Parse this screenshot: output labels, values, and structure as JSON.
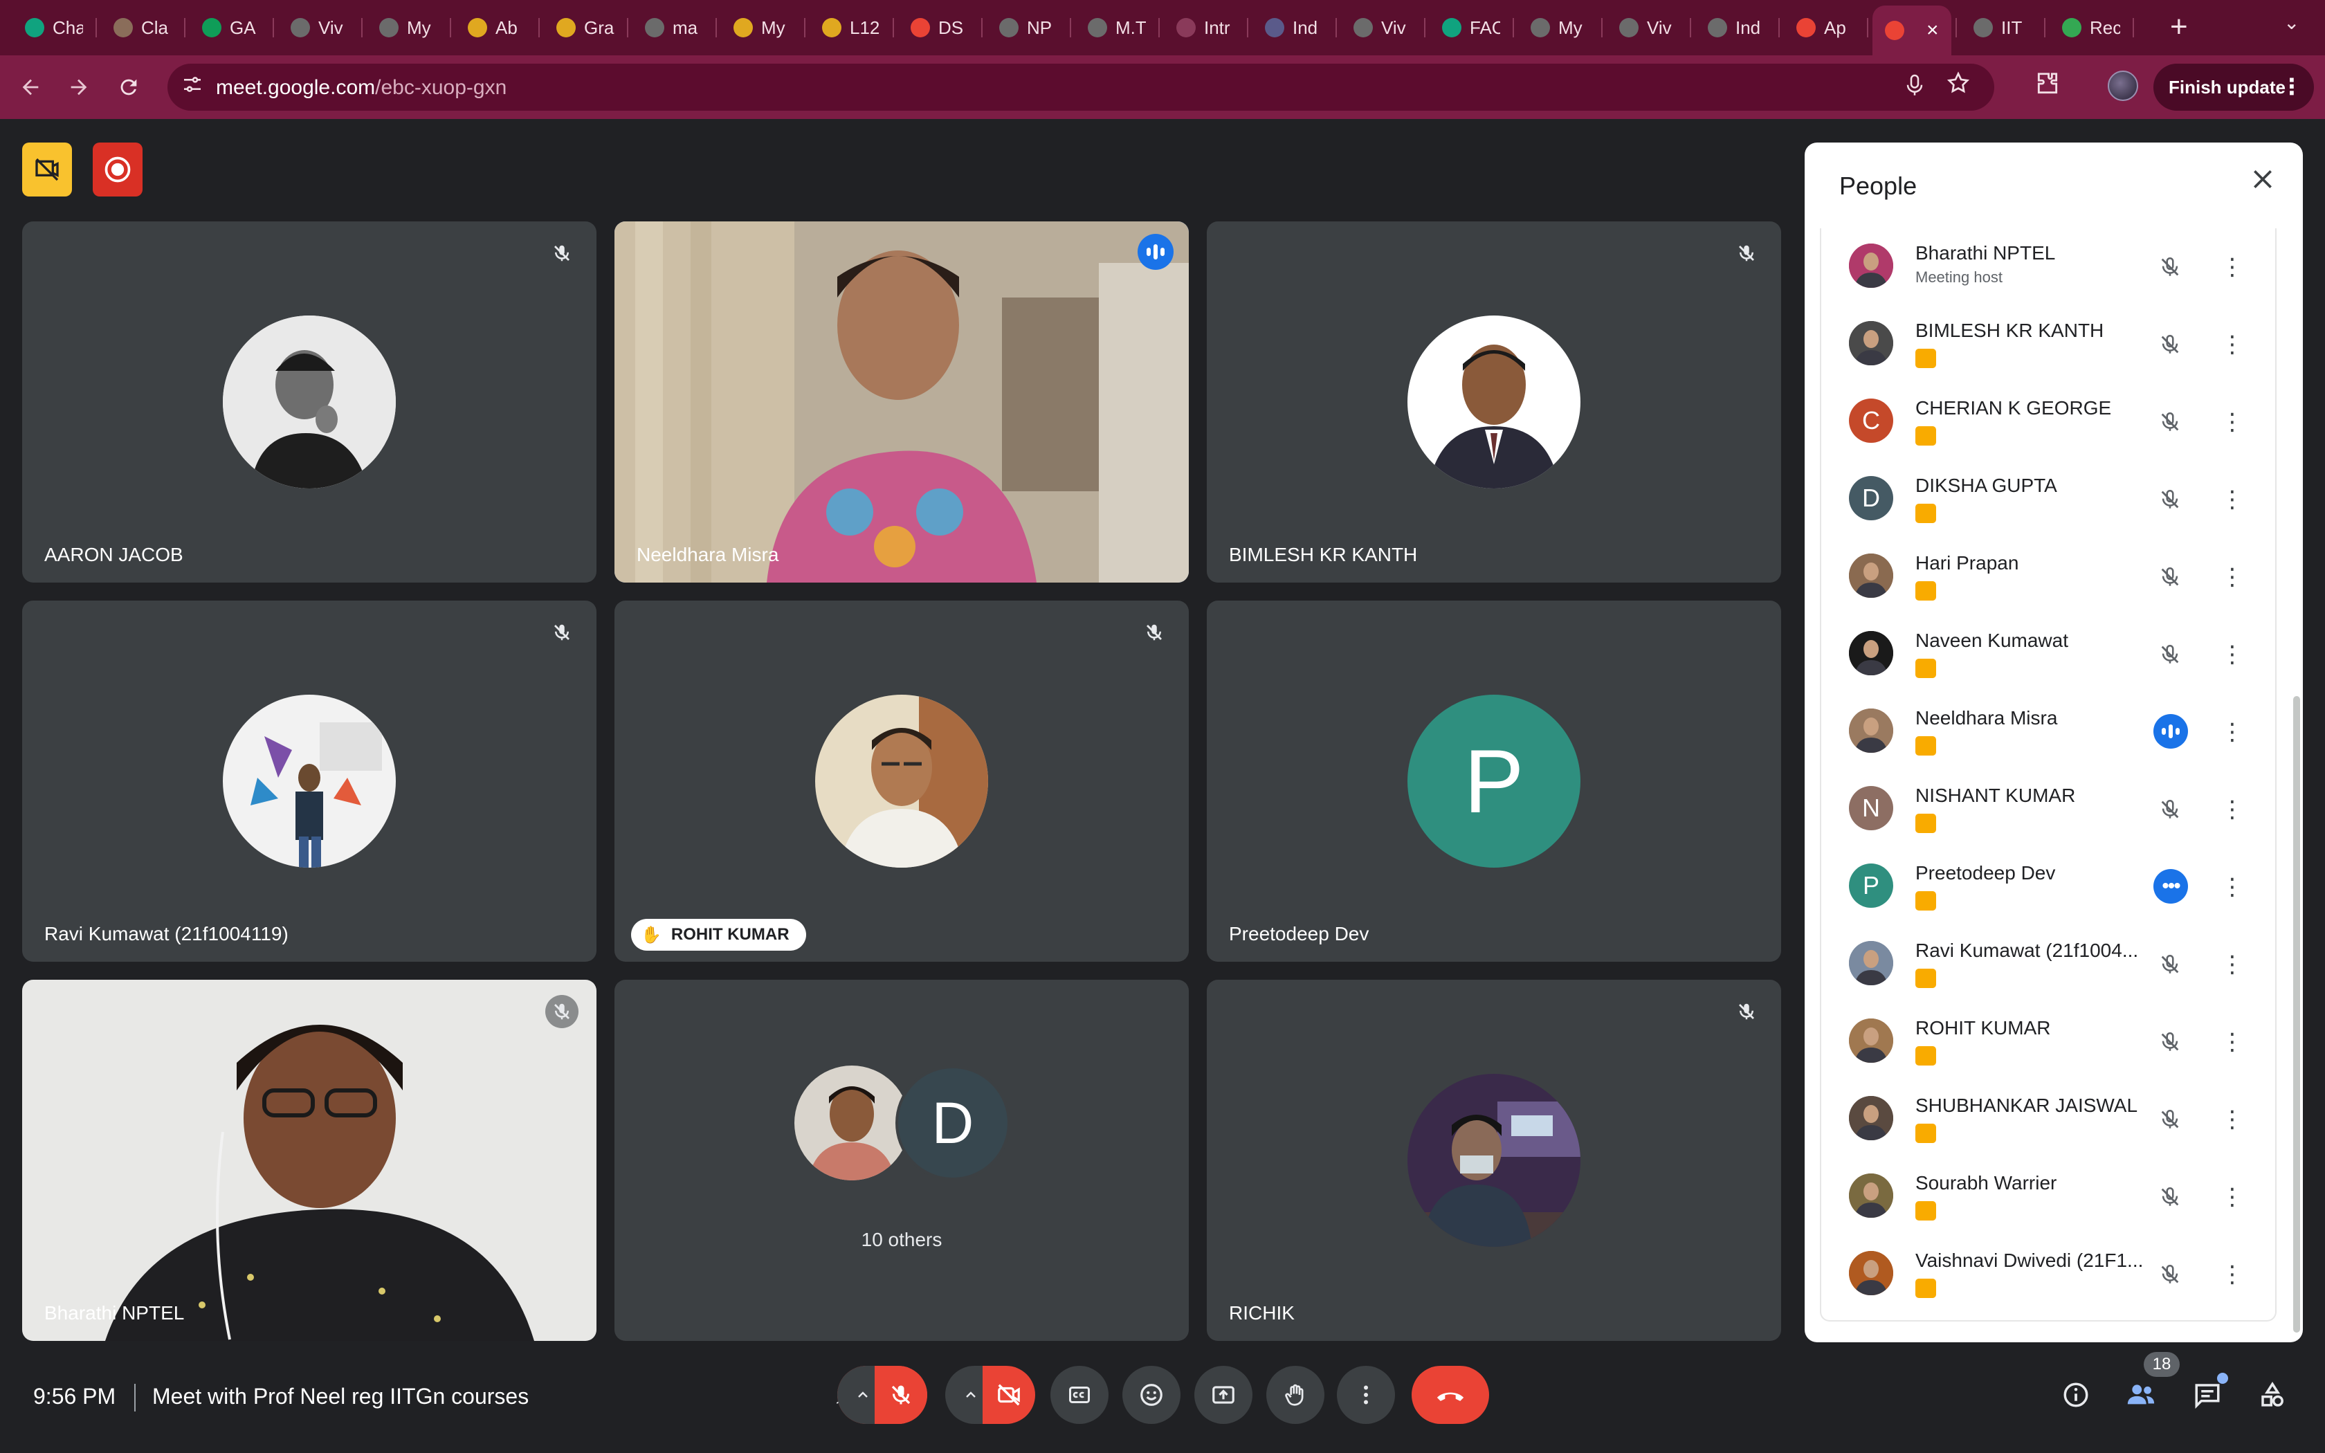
{
  "browser": {
    "tabs": [
      {
        "label": "Cha",
        "icon": "chatgpt-icon",
        "color": "#10a37f"
      },
      {
        "label": "Cla",
        "icon": "generic-app-icon",
        "color": "#8a6d5a"
      },
      {
        "label": "GA",
        "icon": "google-sheets-icon",
        "color": "#0f9d58"
      },
      {
        "label": "Viv",
        "icon": "globe-icon",
        "color": "#6b6b6b"
      },
      {
        "label": "My",
        "icon": "generic-app-icon",
        "color": "#6b6b6b"
      },
      {
        "label": "Ab",
        "icon": "smiley-icon",
        "color": "#e0a820"
      },
      {
        "label": "Gra",
        "icon": "smiley-icon",
        "color": "#e0a820"
      },
      {
        "label": "ma",
        "icon": "globe-icon",
        "color": "#6b6b6b"
      },
      {
        "label": "My",
        "icon": "smiley-icon",
        "color": "#e0a820"
      },
      {
        "label": "L12",
        "icon": "smiley-icon",
        "color": "#e0a820"
      },
      {
        "label": "DS",
        "icon": "gmail-icon",
        "color": "#ea4335"
      },
      {
        "label": "NP",
        "icon": "generic-app-icon",
        "color": "#6b6b6b"
      },
      {
        "label": "M.T",
        "icon": "generic-app-icon",
        "color": "#6b6b6b"
      },
      {
        "label": "Intr",
        "icon": "generic-app-icon",
        "color": "#8a3a5a"
      },
      {
        "label": "Ind",
        "icon": "generic-app-icon",
        "color": "#5a5a8a"
      },
      {
        "label": "Viv",
        "icon": "globe-icon",
        "color": "#6b6b6b"
      },
      {
        "label": "FAC",
        "icon": "chatgpt-icon",
        "color": "#10a37f"
      },
      {
        "label": "My",
        "icon": "generic-app-icon",
        "color": "#6b6b6b"
      },
      {
        "label": "Viv",
        "icon": "globe-icon",
        "color": "#6b6b6b"
      },
      {
        "label": "Ind",
        "icon": "generic-app-icon",
        "color": "#6b6b6b"
      },
      {
        "label": "Ap",
        "icon": "gmail-icon",
        "color": "#ea4335"
      },
      {
        "label": "",
        "icon": "meet-record-icon",
        "color": "#ea4335",
        "active": true
      },
      {
        "label": "IIT",
        "icon": "globe-icon",
        "color": "#6b6b6b"
      },
      {
        "label": "Rec",
        "icon": "google-drive-icon",
        "color": "#34a853"
      }
    ],
    "url_host": "meet.google.com",
    "url_path": "/ebc-xuop-gxn",
    "finish_update_label": "Finish update",
    "new_tab_label": "+"
  },
  "meeting": {
    "time": "9:56 PM",
    "title": "Meet with Prof Neel reg IITGn courses",
    "tiles": [
      {
        "name": "AARON JACOB",
        "type": "avatar-photo",
        "muted": true
      },
      {
        "name": "Neeldhara Misra",
        "type": "video",
        "speaking": true
      },
      {
        "name": "BIMLESH KR KANTH",
        "type": "avatar-photo",
        "muted": true
      },
      {
        "name": "Ravi Kumawat (21f1004119)",
        "type": "avatar-photo",
        "muted": true
      },
      {
        "name": "ROHIT KUMAR",
        "type": "avatar-photo",
        "muted": true,
        "hand_raised": true
      },
      {
        "name": "Preetodeep Dev",
        "type": "avatar-letter",
        "letter": "P",
        "color": "#2f8f7f"
      },
      {
        "name": "Bharathi NPTEL",
        "type": "video",
        "muted": true
      },
      {
        "name": "10 others",
        "type": "others",
        "letter": "D"
      },
      {
        "name": "RICHIK",
        "type": "avatar-photo",
        "muted": true
      }
    ],
    "participant_count": "18"
  },
  "people_panel": {
    "title": "People",
    "participants": [
      {
        "name": "Bharathi NPTEL",
        "subtitle": "Meeting host",
        "avatar": "photo",
        "color": "#b03a6a",
        "state": "muted"
      },
      {
        "name": "BIMLESH KR KANTH",
        "avatar": "photo",
        "color": "#4a4a4a",
        "state": "muted"
      },
      {
        "name": "CHERIAN K GEORGE",
        "avatar": "letter",
        "letter": "C",
        "color": "#c5492a",
        "state": "muted"
      },
      {
        "name": "DIKSHA GUPTA",
        "avatar": "letter",
        "letter": "D",
        "color": "#455a64",
        "state": "muted"
      },
      {
        "name": "Hari Prapan",
        "avatar": "photo",
        "color": "#8a6a50",
        "state": "muted"
      },
      {
        "name": "Naveen Kumawat",
        "avatar": "photo",
        "color": "#1a1a1a",
        "state": "muted"
      },
      {
        "name": "Neeldhara Misra",
        "avatar": "photo",
        "color": "#9a7a60",
        "state": "speaking"
      },
      {
        "name": "NISHANT KUMAR",
        "avatar": "letter",
        "letter": "N",
        "color": "#8d6e63",
        "state": "muted"
      },
      {
        "name": "Preetodeep Dev",
        "avatar": "letter",
        "letter": "P",
        "color": "#2f8f7f",
        "state": "more"
      },
      {
        "name": "Ravi Kumawat (21f1004...",
        "avatar": "photo",
        "color": "#7a8aa0",
        "state": "muted"
      },
      {
        "name": "ROHIT KUMAR",
        "avatar": "photo",
        "color": "#a07850",
        "state": "muted"
      },
      {
        "name": "SHUBHANKAR JAISWAL",
        "avatar": "photo",
        "color": "#5a4a40",
        "state": "muted"
      },
      {
        "name": "Sourabh Warrier",
        "avatar": "photo",
        "color": "#7a6a40",
        "state": "muted"
      },
      {
        "name": "Vaishnavi Dwivedi (21F1...",
        "avatar": "photo",
        "color": "#b05a20",
        "state": "muted"
      }
    ]
  },
  "colors": {
    "tab_strip": "#5a0f2e",
    "toolbar": "#7d1d45",
    "stage": "#202124",
    "tile": "#3c4043",
    "danger": "#ea4335",
    "accent": "#1a73e8",
    "warn": "#f9ab00"
  }
}
